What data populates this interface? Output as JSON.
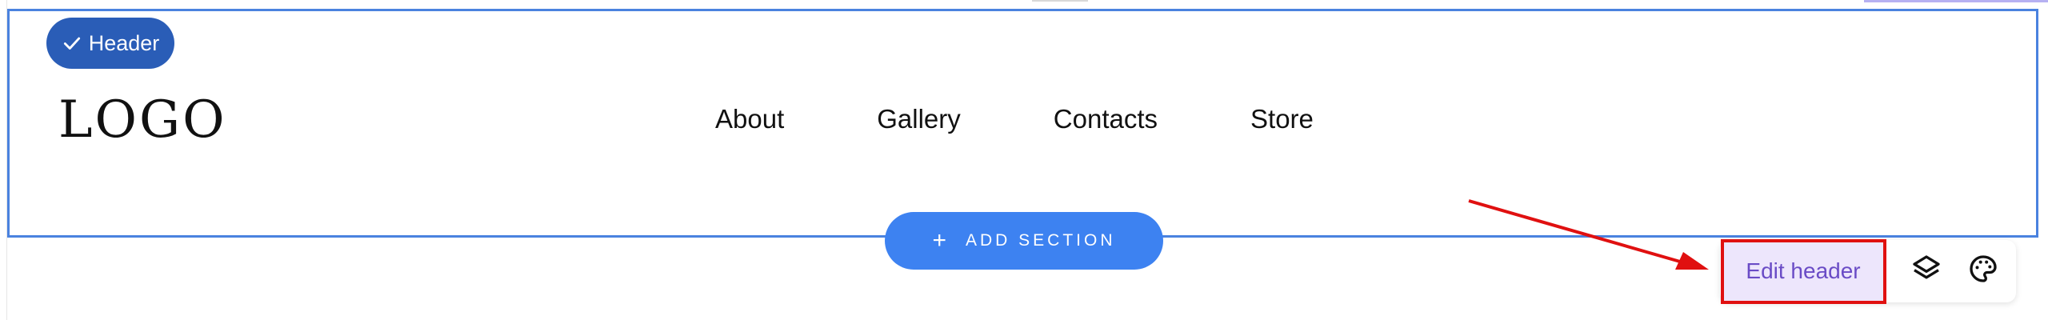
{
  "header_badge": {
    "label": "Header",
    "icon": "check-icon"
  },
  "logo": {
    "text": "LOGO"
  },
  "nav": {
    "items": [
      "About",
      "Gallery",
      "Contacts",
      "Store"
    ]
  },
  "add_section": {
    "label": "ADD SECTION",
    "icon": "plus-icon"
  },
  "toolbar": {
    "edit_label": "Edit header",
    "layers_icon": "layers-icon",
    "palette_icon": "palette-icon"
  },
  "colors": {
    "frame": "#4a82df",
    "badge": "#2a5db7",
    "add_section": "#3d82f1",
    "edit_button_bg": "#ede6fc",
    "edit_button_text": "#6a4cc6",
    "annotation_red": "#e01010"
  }
}
